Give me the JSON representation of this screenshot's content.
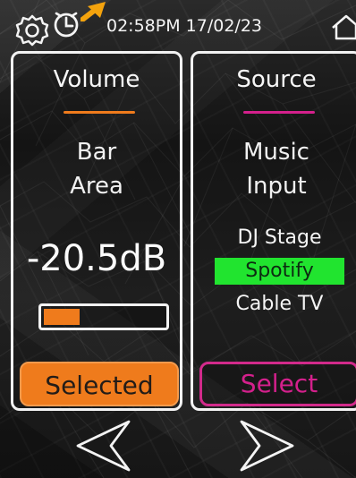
{
  "status_bar": {
    "time": "02:58PM",
    "date": "17/02/23",
    "icons": {
      "settings": "gear-icon",
      "clock": "clock-icon",
      "home": "home-icon",
      "pointer": "arrow-icon"
    }
  },
  "volume_panel": {
    "title": "Volume",
    "area_line1": "Bar",
    "area_line2": "Area",
    "value": "-20.5dB",
    "level_percent": 30,
    "button_label": "Selected",
    "accent": "#ef7b1c"
  },
  "source_panel": {
    "title": "Source",
    "line1": "Music",
    "line2": "Input",
    "options": [
      {
        "label": "DJ Stage"
      },
      {
        "label": "Spotify"
      },
      {
        "label": "Cable TV"
      }
    ],
    "selected_option": "Spotify",
    "button_label": "Select",
    "accent": "#d4208c",
    "selected_color": "#21e42f"
  },
  "navigation": {
    "left_icon": "chevron-left-icon",
    "right_icon": "chevron-right-icon"
  }
}
